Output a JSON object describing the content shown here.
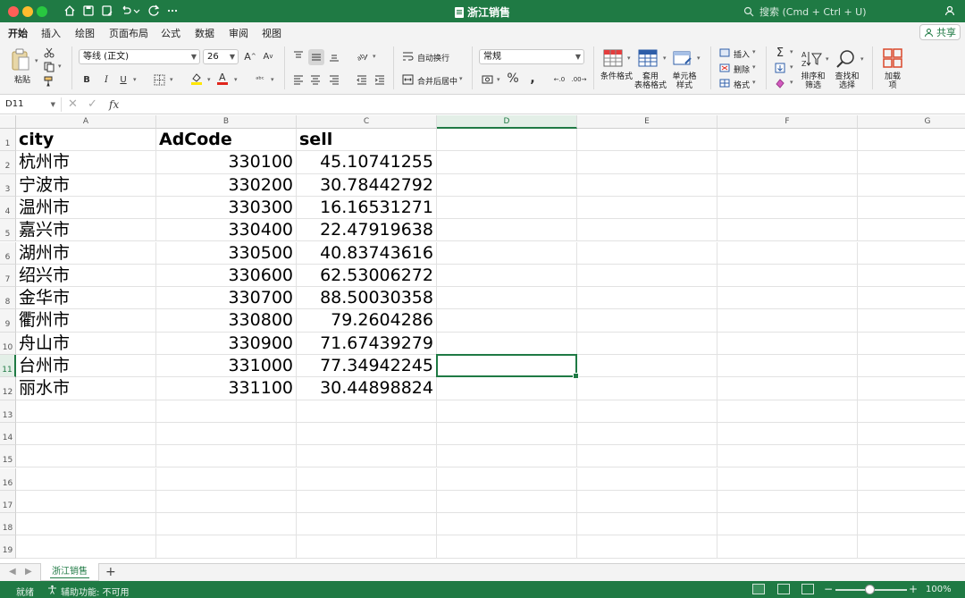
{
  "window": {
    "title": "浙江销售"
  },
  "search": {
    "placeholder": "搜索 (Cmd + Ctrl + U)"
  },
  "menu": {
    "tabs": [
      "开始",
      "插入",
      "绘图",
      "页面布局",
      "公式",
      "数据",
      "审阅",
      "视图"
    ],
    "active": "开始",
    "share_label": "共享"
  },
  "ribbon": {
    "paste_label": "粘贴",
    "font_name": "等线 (正文)",
    "font_size": "26",
    "bold": "B",
    "italic": "I",
    "underline": "U",
    "wrap_text": "自动换行",
    "merge_center": "合并后居中",
    "number_format": "常规",
    "conditional_format": "条件格式",
    "table_format": "套用\n表格格式",
    "cell_style": "单元格\n样式",
    "insert": "插入",
    "delete": "删除",
    "format": "格式",
    "sort_filter": "排序和\n筛选",
    "find_select": "查找和\n选择",
    "addins": "加载\n项"
  },
  "formula_bar": {
    "name_box": "D11",
    "formula": ""
  },
  "columns": [
    "A",
    "B",
    "C",
    "D",
    "E",
    "F",
    "G"
  ],
  "rows": [
    "1",
    "2",
    "3",
    "4",
    "5",
    "6",
    "7",
    "8",
    "9",
    "10",
    "11",
    "12",
    "13",
    "14",
    "15",
    "16",
    "17",
    "18",
    "19"
  ],
  "active_cell": "D11",
  "table": {
    "headers": [
      "city",
      "AdCode",
      "sell"
    ],
    "rows": [
      [
        "杭州市",
        "330100",
        "45.10741255"
      ],
      [
        "宁波市",
        "330200",
        "30.78442792"
      ],
      [
        "温州市",
        "330300",
        "16.16531271"
      ],
      [
        "嘉兴市",
        "330400",
        "22.47919638"
      ],
      [
        "湖州市",
        "330500",
        "40.83743616"
      ],
      [
        "绍兴市",
        "330600",
        "62.53006272"
      ],
      [
        "金华市",
        "330700",
        "88.50030358"
      ],
      [
        "衢州市",
        "330800",
        "79.2604286"
      ],
      [
        "舟山市",
        "330900",
        "71.67439279"
      ],
      [
        "台州市",
        "331000",
        "77.34942245"
      ],
      [
        "丽水市",
        "331100",
        "30.44898824"
      ]
    ]
  },
  "sheets": {
    "tabs": [
      "浙江销售"
    ],
    "active": "浙江销售"
  },
  "status": {
    "ready": "就绪",
    "accessibility": "辅助功能: 不可用",
    "zoom": "100%"
  },
  "colors": {
    "accent": "#1f7a44",
    "font_color": "#e0261c",
    "highlight": "#ffe600"
  }
}
